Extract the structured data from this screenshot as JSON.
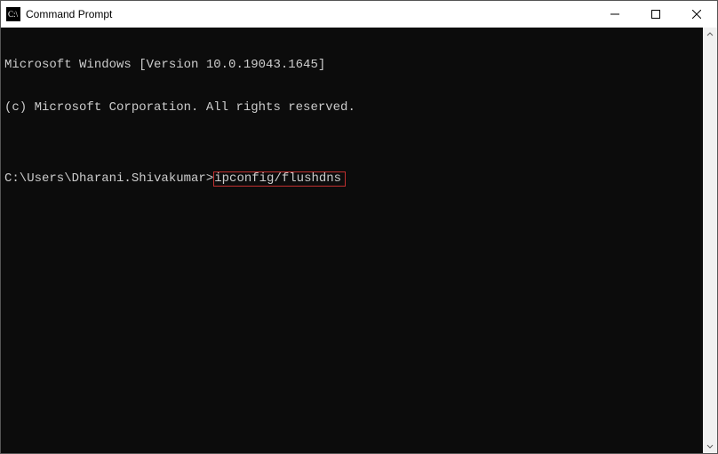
{
  "titlebar": {
    "title": "Command Prompt",
    "icon": "cmd-icon"
  },
  "controls": {
    "minimize": "minimize",
    "maximize": "maximize",
    "close": "close"
  },
  "terminal": {
    "line1": "Microsoft Windows [Version 10.0.19043.1645]",
    "line2": "(c) Microsoft Corporation. All rights reserved.",
    "blank": "",
    "prompt_prefix": "C:\\Users\\Dharani.Shivakumar>",
    "command": "ipconfig/flushdns"
  },
  "scrollbar": {
    "up": "up-arrow",
    "down": "down-arrow"
  }
}
